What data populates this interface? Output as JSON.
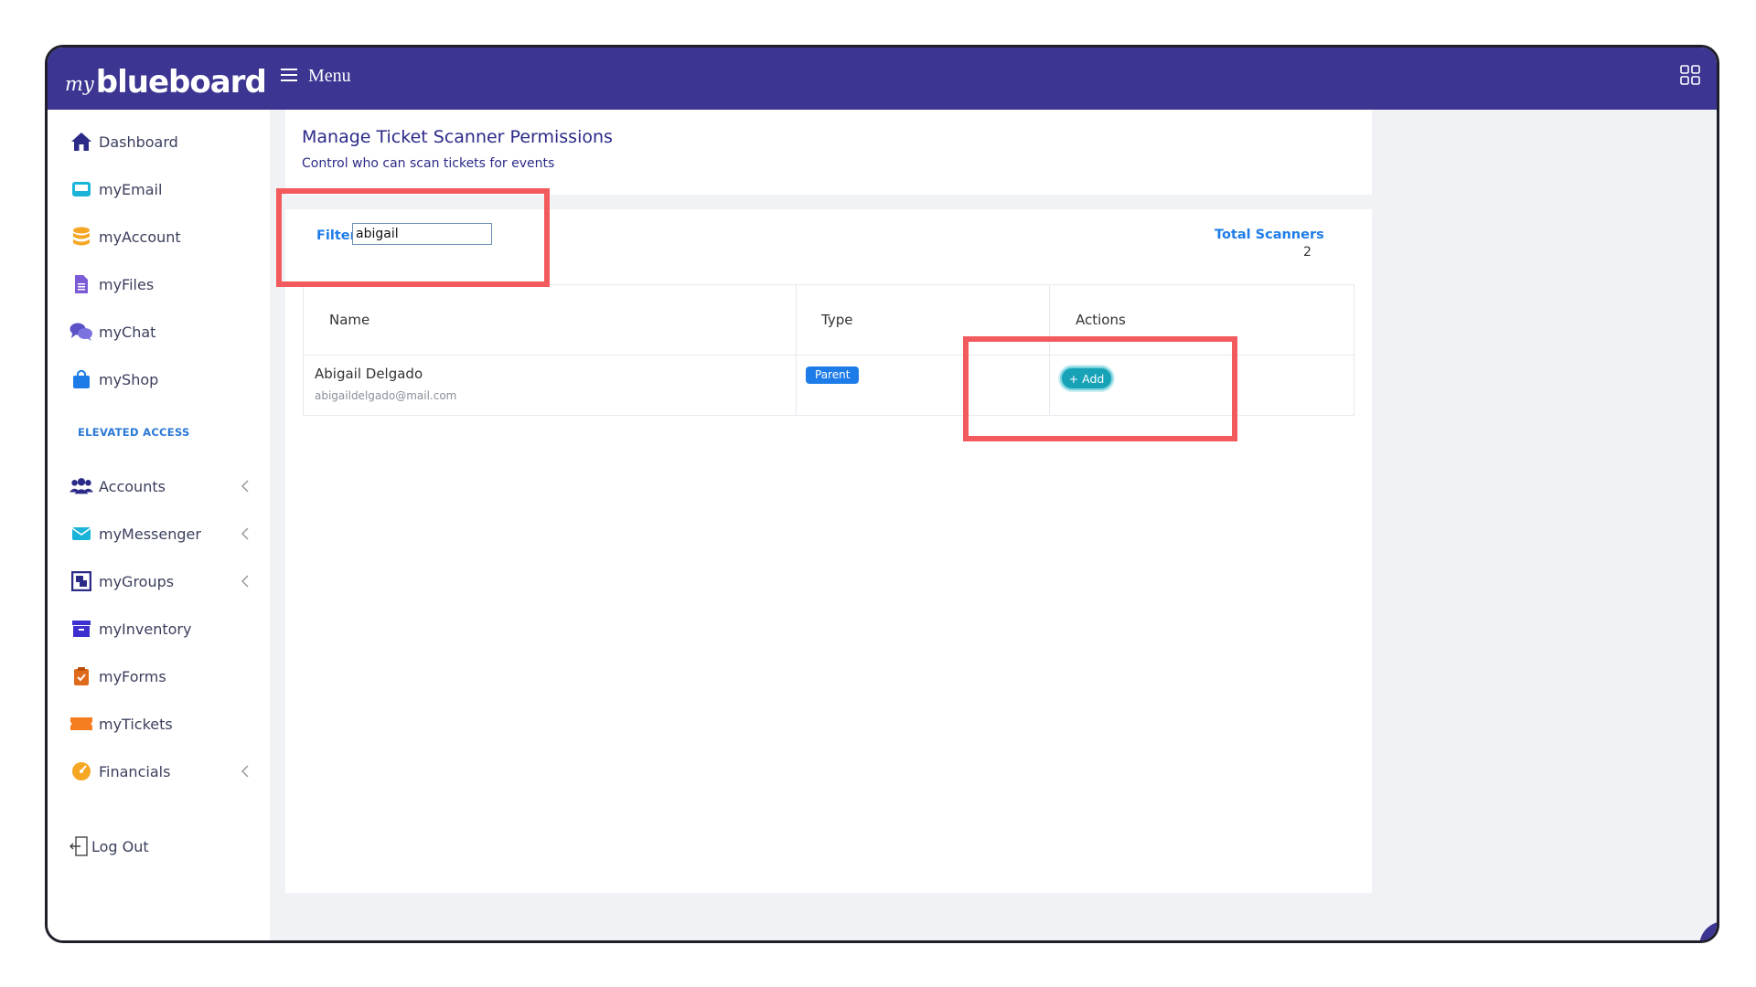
{
  "app": {
    "logo_my": "my",
    "logo_main": "blueboard",
    "menu_label": "Menu"
  },
  "colors": {
    "brand": "#3c3592",
    "accent": "#1e7ce8",
    "add": "#17a2b8",
    "highlight": "#f25a5d"
  },
  "sidebar": {
    "items": [
      {
        "label": "Dashboard",
        "icon": "home-icon"
      },
      {
        "label": "myEmail",
        "icon": "inbox-icon"
      },
      {
        "label": "myAccount",
        "icon": "database-icon"
      },
      {
        "label": "myFiles",
        "icon": "file-icon"
      },
      {
        "label": "myChat",
        "icon": "chat-icon"
      },
      {
        "label": "myShop",
        "icon": "shopping-bag-icon"
      }
    ],
    "section_label": "ELEVATED ACCESS",
    "elevated": [
      {
        "label": "Accounts",
        "icon": "users-icon"
      },
      {
        "label": "myMessenger",
        "icon": "envelope-icon"
      },
      {
        "label": "myGroups",
        "icon": "groups-icon"
      },
      {
        "label": "myInventory",
        "icon": "archive-icon"
      },
      {
        "label": "myForms",
        "icon": "clipboard-check-icon"
      },
      {
        "label": "myTickets",
        "icon": "ticket-icon"
      },
      {
        "label": "Financials",
        "icon": "gauge-icon"
      }
    ],
    "logout": "Log Out"
  },
  "page": {
    "title": "Manage Ticket Scanner Permissions",
    "subtitle": "Control who can scan tickets for events"
  },
  "filter": {
    "label": "Filter",
    "value": "abigail"
  },
  "total": {
    "label": "Total Scanners",
    "value": "2"
  },
  "table": {
    "headers": [
      "Name",
      "Type",
      "Actions"
    ],
    "rows": [
      {
        "name": "Abigail Delgado",
        "email": "abigaildelgado@mail.com",
        "type": "Parent",
        "action": "+ Add"
      }
    ]
  }
}
